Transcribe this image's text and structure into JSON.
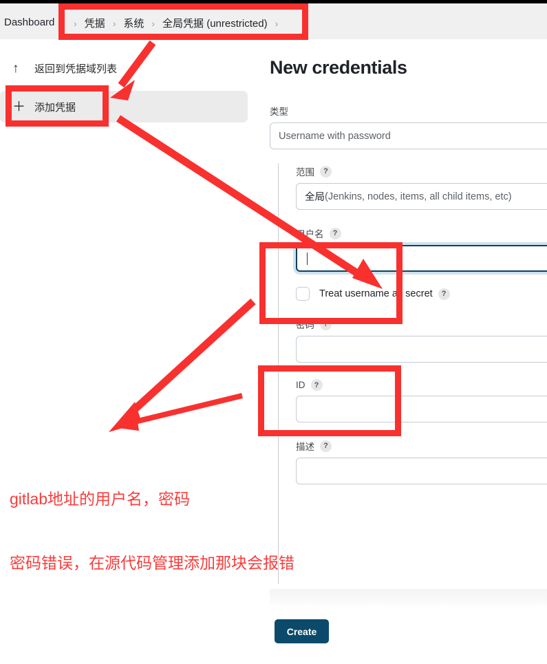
{
  "header": {
    "dashboard_label": "Dashboard",
    "separator": "›",
    "crumbs": [
      {
        "label": "凭据"
      },
      {
        "label": "系统"
      },
      {
        "label": "全局凭据 (unrestricted)"
      }
    ]
  },
  "sidebar": {
    "items": [
      {
        "icon": "up-arrow-icon",
        "glyph": "↑",
        "label": "返回到凭据域列表"
      },
      {
        "icon": "plus-icon",
        "glyph": "＋",
        "label": "添加凭据"
      }
    ]
  },
  "main": {
    "title": "New credentials",
    "type": {
      "label": "类型",
      "value": "Username with password"
    },
    "scope": {
      "label": "范围",
      "help": "?",
      "value_strong": "全局",
      "value_rest": " (Jenkins, nodes, items, all child items, etc)"
    },
    "username": {
      "label": "用户名",
      "help": "?",
      "value": ""
    },
    "treat_secret": {
      "label": "Treat username as secret",
      "help": "?",
      "checked": false
    },
    "password": {
      "label": "密码",
      "help": "?",
      "value": ""
    },
    "id": {
      "label": "ID",
      "help": "?",
      "value": ""
    },
    "description": {
      "label": "描述",
      "help": "?",
      "value": ""
    },
    "create_button": "Create"
  },
  "annotations": {
    "note_line1": "gitlab地址的用户名，密码",
    "note_line2": "密码错误，在源代码管理添加那块会报错",
    "highlight_color": "#f8312f",
    "text_color": "#fa3c3c"
  },
  "colors": {
    "accent_button": "#0b4a6b",
    "focus_border": "#10405c",
    "focus_glow": "#cfe2ef",
    "header_bg": "#f0f0f0",
    "hover_row_bg": "#ebebeb"
  }
}
